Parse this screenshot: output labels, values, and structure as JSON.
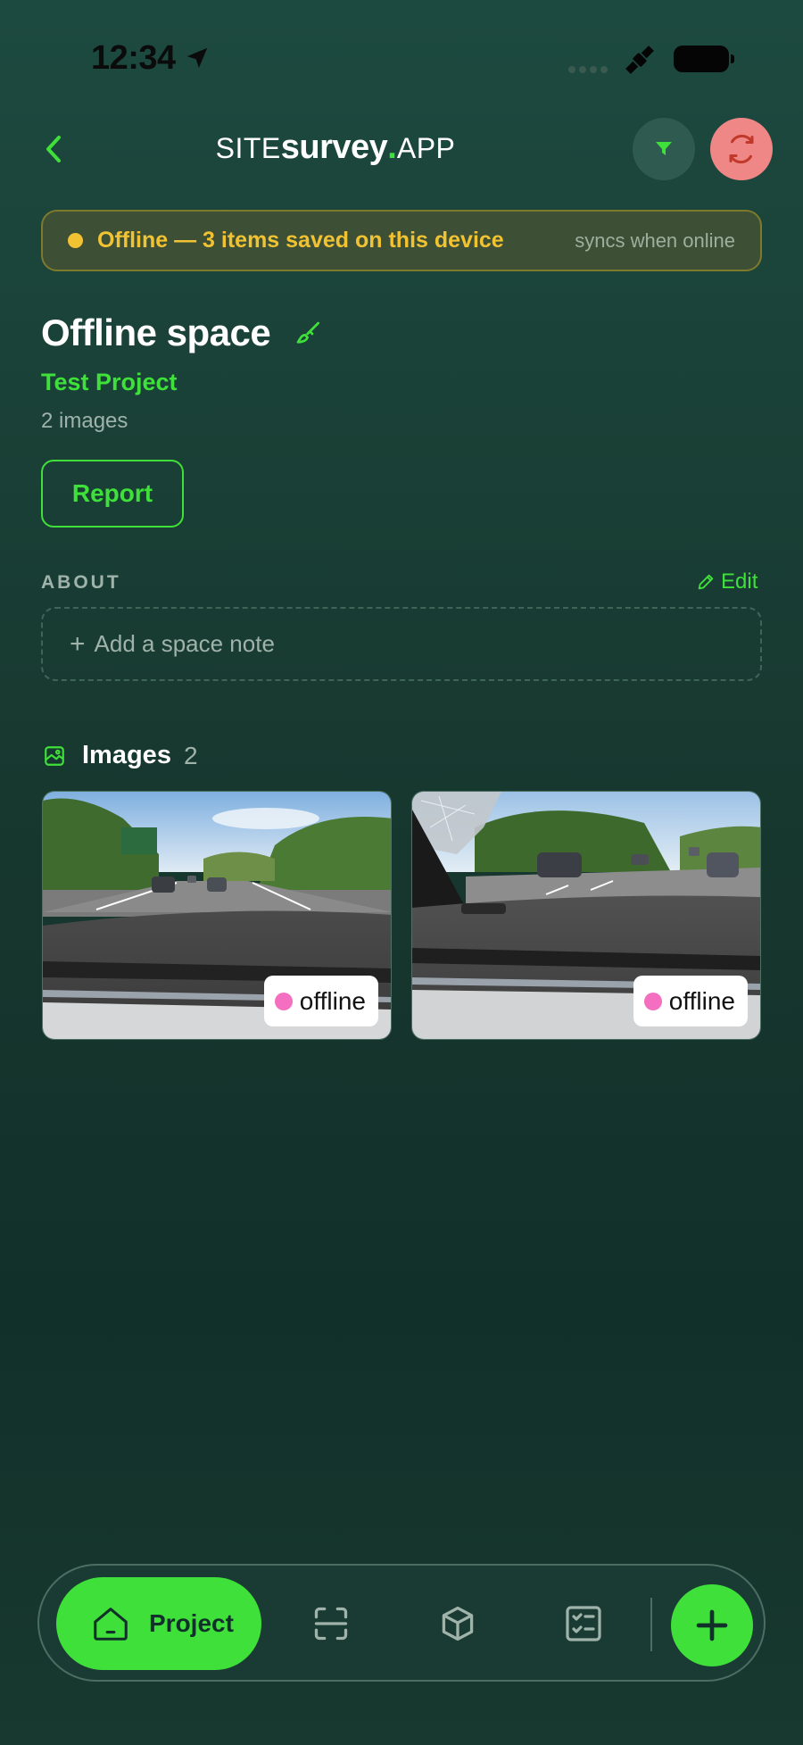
{
  "status_bar": {
    "time": "12:34"
  },
  "header": {
    "brand_site": "SITE",
    "brand_survey": "survey",
    "brand_dot": ".",
    "brand_app": "APP"
  },
  "banner": {
    "message": "Offline — 3 items saved on this device",
    "sync_note": "syncs when online"
  },
  "space": {
    "title": "Offline space",
    "project": "Test Project",
    "image_count": "2 images",
    "report_label": "Report"
  },
  "about": {
    "label": "ABOUT",
    "edit_label": "Edit",
    "note_plus": "+",
    "note_placeholder": "Add a space note"
  },
  "images": {
    "title": "Images",
    "count": "2",
    "items": [
      {
        "badge": "offline"
      },
      {
        "badge": "offline"
      }
    ]
  },
  "nav": {
    "project_label": "Project"
  },
  "colors": {
    "accent": "#3fe03a",
    "warning": "#f1c232",
    "sync_button": "#f08787",
    "offline_dot": "#f46fc0"
  },
  "icons": [
    "location-arrow-icon",
    "satellite-icon",
    "battery-icon",
    "chevron-left-icon",
    "filter-icon",
    "sync-icon",
    "brush-icon",
    "pencil-icon",
    "image-icon",
    "home-icon",
    "scan-icon",
    "cube-icon",
    "checklist-icon",
    "plus-icon"
  ]
}
